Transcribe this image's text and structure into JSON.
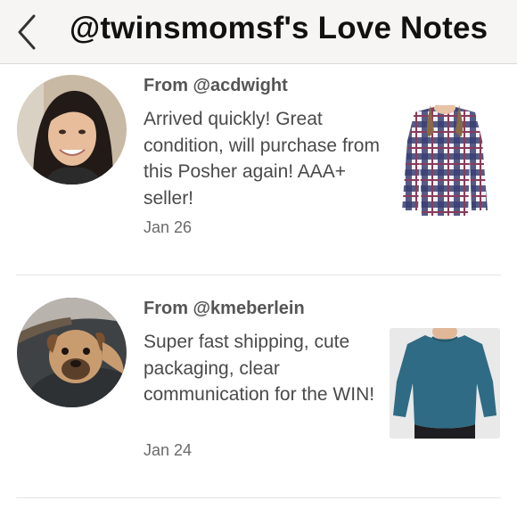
{
  "header": {
    "title": "@twinsmomsf's Love Notes",
    "back_icon": "chevron-left-icon"
  },
  "notes": [
    {
      "from": "From @acdwight",
      "message": "Arrived quickly! Great condition, will purchase from this Posher again! AAA+ seller!",
      "date": "Jan 26"
    },
    {
      "from": "From @kmeberlein",
      "message": "Super fast shipping, cute packaging, clear communication for the WIN!",
      "date": "Jan 24"
    }
  ],
  "colors": {
    "header_bg": "#f7f5f3",
    "text": "#4a4a4a",
    "divider": "#e6e4e1"
  }
}
